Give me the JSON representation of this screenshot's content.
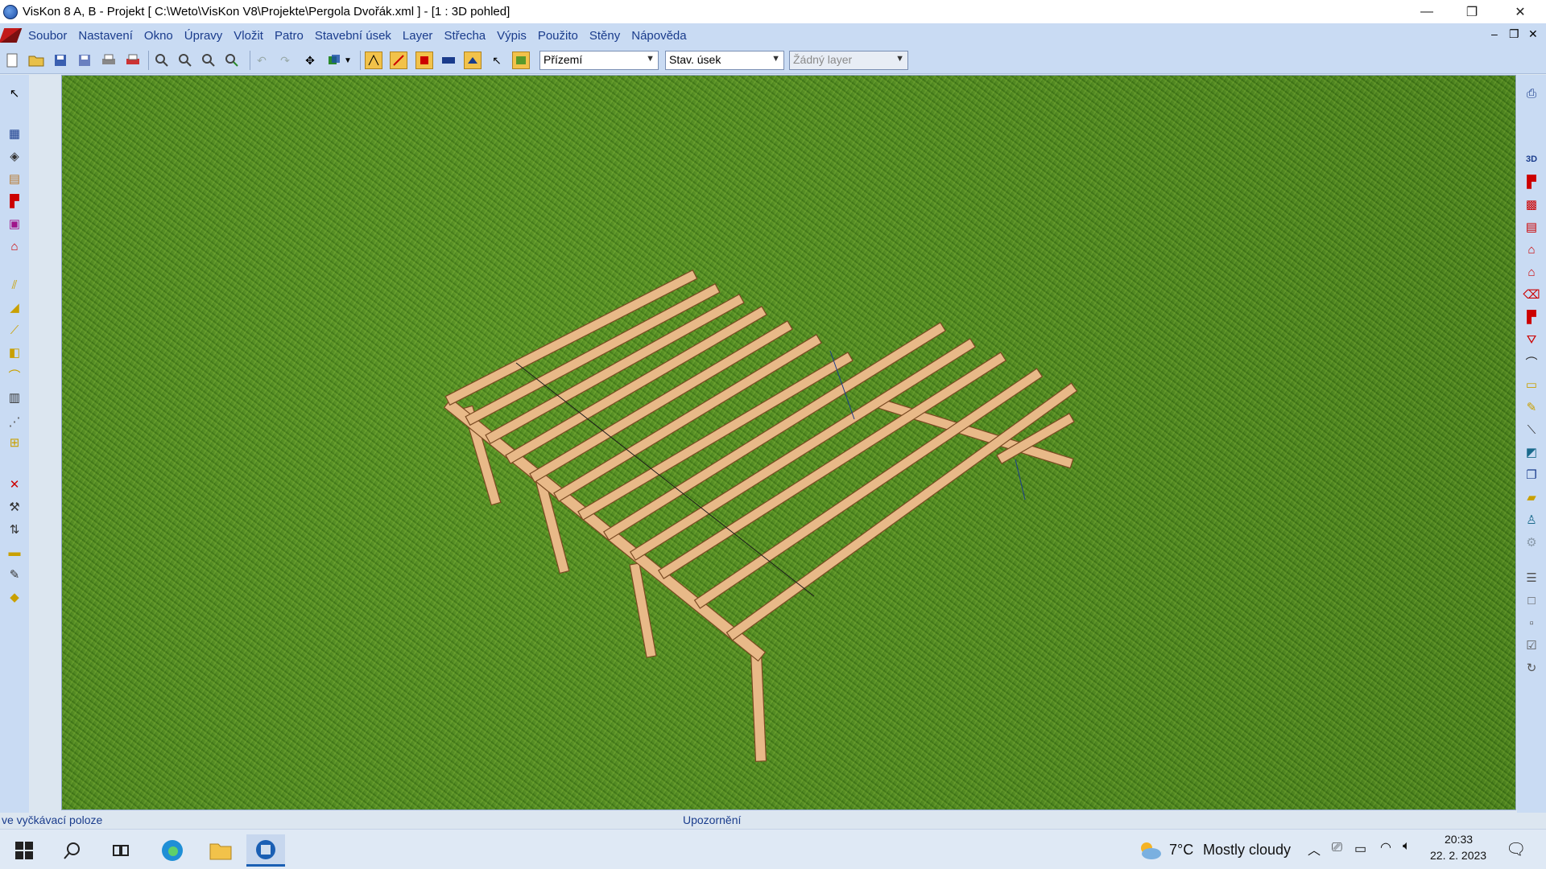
{
  "window": {
    "title": "VisKon 8 A, B - Projekt [ C:\\Weto\\VisKon V8\\Projekte\\Pergola Dvořák.xml ]  - [1 : 3D pohled]",
    "minimize_glyph": "—",
    "restore_glyph": "❐",
    "close_glyph": "✕"
  },
  "menu": {
    "items": [
      "Soubor",
      "Nastavení",
      "Okno",
      "Úpravy",
      "Vložit",
      "Patro",
      "Stavební úsek",
      "Layer",
      "Střecha",
      "Výpis",
      "Použito",
      "Stěny",
      "Nápověda"
    ],
    "mdi_min": "‒",
    "mdi_restore": "❐",
    "mdi_close": "✕"
  },
  "toolbar": {
    "floor_select": "Přízemí",
    "section_select": "Stav. úsek",
    "layer_select": "Žádný layer"
  },
  "statusbar": {
    "left_text": "ve vyčkávací poloze",
    "center_text": "Upozornění"
  },
  "taskbar": {
    "weather_temp": "7°C",
    "weather_desc": "Mostly cloudy",
    "time": "20:33",
    "date": "22. 2. 2023"
  },
  "icons": {
    "app": "viskon-app-icon",
    "colors": {
      "wood": "#e8b988",
      "wood_edge": "#7a4a22",
      "grass": "#4f8a22",
      "accent": "#1a3c8c"
    }
  }
}
